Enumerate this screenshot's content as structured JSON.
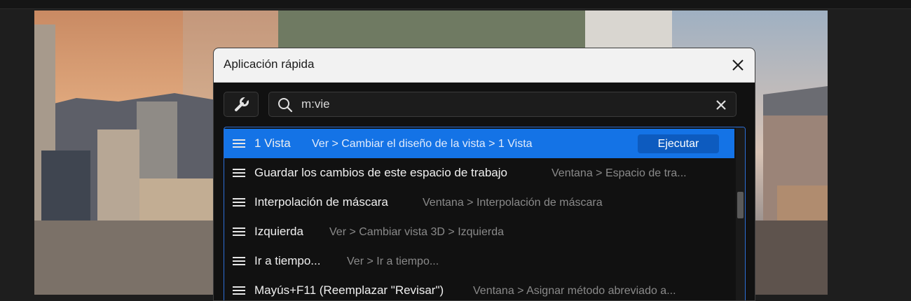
{
  "dialog": {
    "title": "Aplicación rápida",
    "search": {
      "value": "m:vie",
      "placeholder": ""
    },
    "execute_label": "Ejecutar",
    "results": [
      {
        "label": "1 Vista",
        "path": "Ver > Cambiar el diseño de la vista > 1 Vista",
        "selected": true
      },
      {
        "label": "Guardar los cambios de este espacio de trabajo",
        "path": "Ventana > Espacio de tra...",
        "selected": false
      },
      {
        "label": "Interpolación de máscara",
        "path": "Ventana > Interpolación de máscara",
        "selected": false
      },
      {
        "label": "Izquierda",
        "path": "Ver > Cambiar vista 3D > Izquierda",
        "selected": false
      },
      {
        "label": "Ir a tiempo...",
        "path": "Ver > Ir a tiempo...",
        "selected": false
      },
      {
        "label": "Mayús+F11 (Reemplazar \"Revisar\")",
        "path": "Ventana > Asignar método abreviado a...",
        "selected": false
      }
    ]
  },
  "colors": {
    "accent": "#1473e6",
    "execute_button": "#0d5bbf",
    "dialog_bg": "#111111",
    "header_bg": "#f2f2f2"
  },
  "icons": [
    "wrench-icon",
    "search-icon",
    "clear-icon",
    "close-icon",
    "menu-icon"
  ]
}
